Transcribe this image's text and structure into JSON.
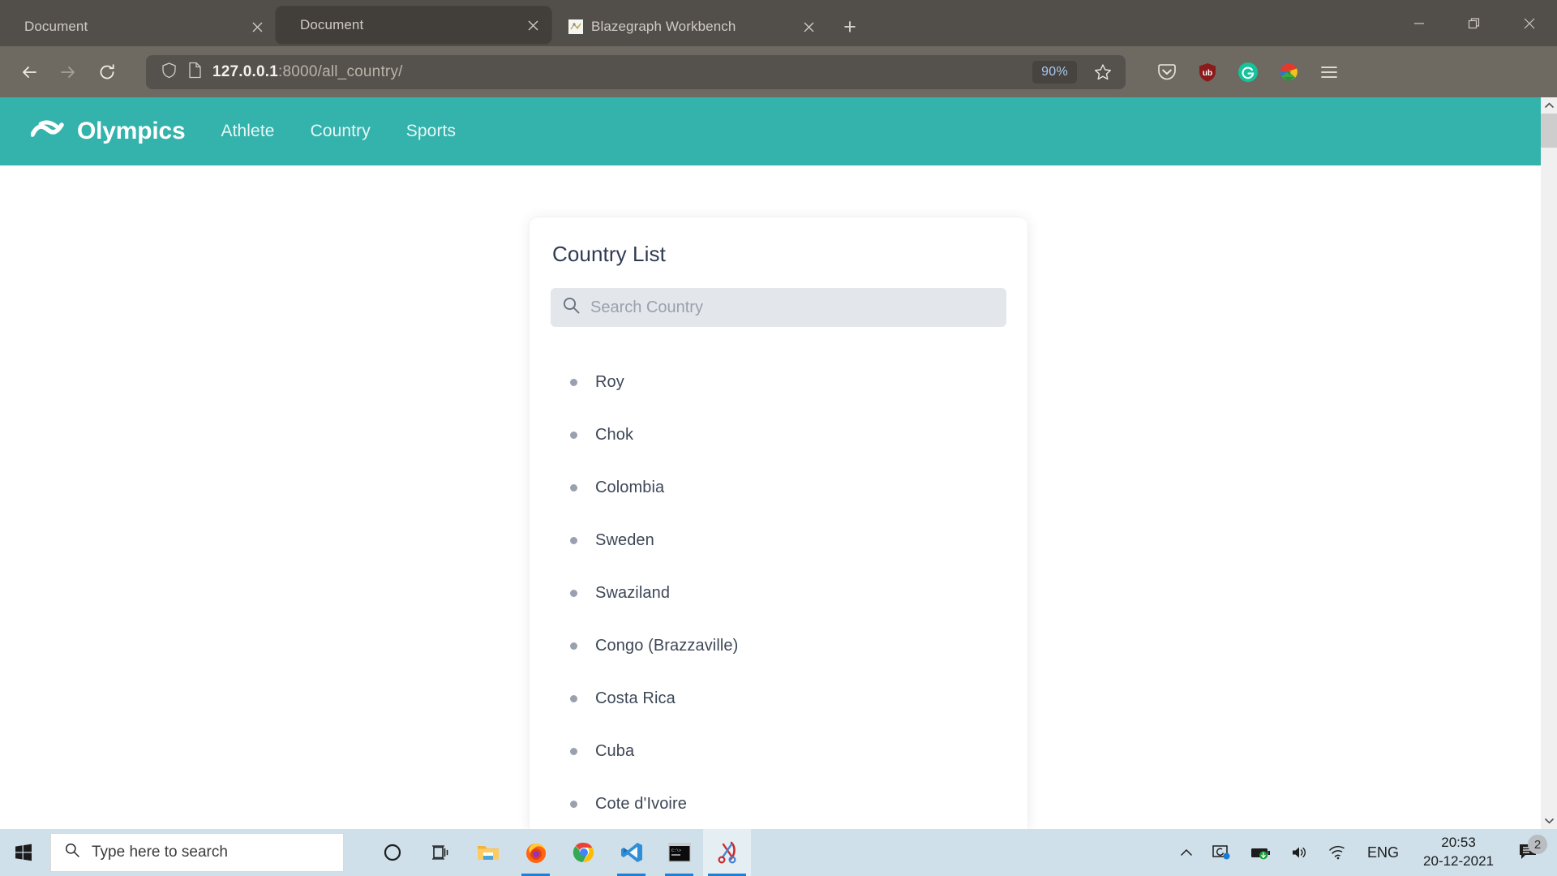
{
  "browser": {
    "tabs": [
      {
        "title": "Document",
        "favicon": "blank-page-icon",
        "active": false
      },
      {
        "title": "Document",
        "favicon": "blank-page-icon",
        "active": true
      },
      {
        "title": "Blazegraph Workbench",
        "favicon": "blazegraph-icon",
        "active": false
      }
    ],
    "new_tab_label": "+",
    "window_controls": {
      "minimize": "minimize-icon",
      "restore": "restore-icon",
      "close": "close-icon"
    },
    "nav": {
      "back": "back-arrow-icon",
      "forward": "forward-arrow-icon",
      "reload": "reload-icon"
    },
    "url": {
      "host": "127.0.0.1",
      "path": ":8000/all_country/",
      "full": "127.0.0.1:8000/all_country/"
    },
    "zoom_level": "90%",
    "bookmark": "star-icon",
    "shield": "shield-icon",
    "page_icon": "page-icon",
    "extensions": [
      {
        "name": "pocket-icon",
        "title": "Pocket"
      },
      {
        "name": "ublock-origin-icon",
        "title": "uBlock Origin"
      },
      {
        "name": "grammarly-icon",
        "title": "Grammarly"
      },
      {
        "name": "idm-icon",
        "title": "Internet Download Manager"
      },
      {
        "name": "app-menu-icon",
        "title": "Open application menu"
      }
    ]
  },
  "site": {
    "brand": "Olympics",
    "logo": "olympics-wave-logo",
    "nav_links": [
      "Athlete",
      "Country",
      "Sports"
    ],
    "accent_color": "#34b2ac"
  },
  "card": {
    "title": "Country List",
    "search": {
      "placeholder": "Search Country",
      "value": "",
      "icon": "search-icon"
    },
    "countries": [
      "Roy",
      "Chok",
      "Colombia",
      "Sweden",
      "Swaziland",
      "Congo (Brazzaville)",
      "Costa Rica",
      "Cuba",
      "Cote d'Ivoire"
    ]
  },
  "taskbar": {
    "start": "windows-start-icon",
    "search_placeholder": "Type here to search",
    "search_icon": "search-icon",
    "apps": [
      {
        "name": "cortana-icon",
        "title": "Cortana",
        "running": false,
        "active": false
      },
      {
        "name": "task-view-icon",
        "title": "Task View",
        "running": false,
        "active": false
      },
      {
        "name": "file-explorer-icon",
        "title": "File Explorer",
        "running": false,
        "active": false
      },
      {
        "name": "firefox-icon",
        "title": "Firefox",
        "running": true,
        "active": false
      },
      {
        "name": "chrome-icon",
        "title": "Google Chrome",
        "running": false,
        "active": false
      },
      {
        "name": "vscode-icon",
        "title": "Visual Studio Code",
        "running": true,
        "active": false
      },
      {
        "name": "command-prompt-icon",
        "title": "Command Prompt",
        "running": true,
        "active": false
      },
      {
        "name": "snipping-tool-icon",
        "title": "Snipping Tool",
        "running": true,
        "active": true
      }
    ],
    "tray": {
      "overflow": "chevron-up-icon",
      "sync": "onedrive-sync-icon",
      "battery": "battery-icon",
      "volume": "volume-icon",
      "network": "wifi-icon",
      "language": "ENG",
      "time": "20:53",
      "date": "20-12-2021",
      "notifications_icon": "notifications-icon",
      "notifications_count": "2"
    }
  }
}
